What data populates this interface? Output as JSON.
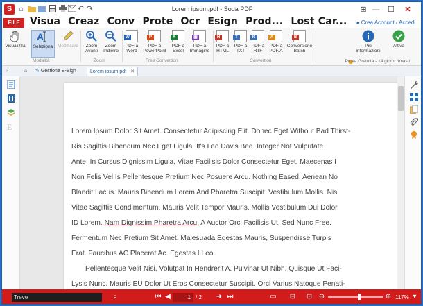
{
  "window": {
    "title": "Lorem ipsum.pdf  -  Soda PDF"
  },
  "tabs": {
    "file": "FILE",
    "items": [
      "Visua",
      "Creaz",
      "Conv",
      "Prote",
      "Ocr",
      "Esign",
      "Prod...",
      "Lost Car..."
    ]
  },
  "account": {
    "link": "▸ Crea Account / Accedi"
  },
  "ribbon": {
    "buttons": {
      "visualizza": "Visualizza",
      "seleziona": "Seleziona",
      "modificare": "Modificare",
      "zoom_avanti": "Zoom Avanti",
      "zoom_indietro": "Zoom Indietro",
      "pdf_word": "PDF a Word",
      "pdf_powerpoint": "PDF a PowerPoint",
      "pdf_excel": "PDF a Excel",
      "pdf_immagine": "PDF a Immagine",
      "pdf_html": "PDF a HTML",
      "pdf_txt": "PDF a TXT",
      "pdf_rtf": "PDF a RTF",
      "pdf_pdfa": "PDF a PDF/A",
      "conversione_batch": "Conversione Batch",
      "piu_informazioni": "Più informazioni",
      "attiva": "Attiva"
    },
    "groups": {
      "modalita": "Modalità",
      "zoom": "Zoom",
      "free_conversion": "Free Convertion",
      "conversion": "Convertion"
    },
    "trial": "Prova Gratuita - 14 giorni rimasti"
  },
  "doc_tabs": {
    "esign": "Gestione E-Sign",
    "pdf": "Lorem ipsum.pdf"
  },
  "document": {
    "lines": [
      "Lorem Ipsum Dolor Sit Amet. Consectetur Adipiscing Elit. Donec Eget Without Bad Thirst-",
      "Ris Sagittis Bibendum Nec Eget Ligula. It's Leo Dav's Bed. Integer Not Vulputate",
      "Ante. In Cursus Dignissim Ligula, Vitae Facilisis Dolor Consectetur Eget. Maecenas I",
      "Non Felis Vel Is Pellentesque Pretium Nec Posuere Arcu. Nothing Eased. Aenean No",
      "Blandit Lacus. Mauris Bibendum Lorem And Pharetra Suscipit. Vestibulum Mollis. Nisi",
      "Vitae Sagittis Condimentum. Mauris Velit Tempor Mauris. Mollis Vestibulum Dui Dolor",
      "ID Lorem.",
      "Nam Dignissim Pharetra Arcu",
      ", A Auctor Orci Facilisis Ut. Sed Nunc Free.",
      "Fermentum Nec Pretium Sit Amet. Malesuada Egestas Mauris, Suspendisse Turpis",
      "Erat. Faucibus AC Placerat Ac. Egestas I Leo.",
      "Pellentesque Velit Nisi, Volutpat In Hendrerit A. Pulvinar Ut Nibh. Quisque Ut Faci-",
      "Lysis Nunc. Mauris EU Dolor Ut Eros Consectetur Suscipit. Orci Varius Natoque Penati-"
    ]
  },
  "statusbar": {
    "find_value": "Treve",
    "page": "1",
    "page_total": "/ 2",
    "zoom": "117%"
  },
  "colors": {
    "accent_red": "#d21c1c",
    "accent_blue": "#2468b8"
  }
}
